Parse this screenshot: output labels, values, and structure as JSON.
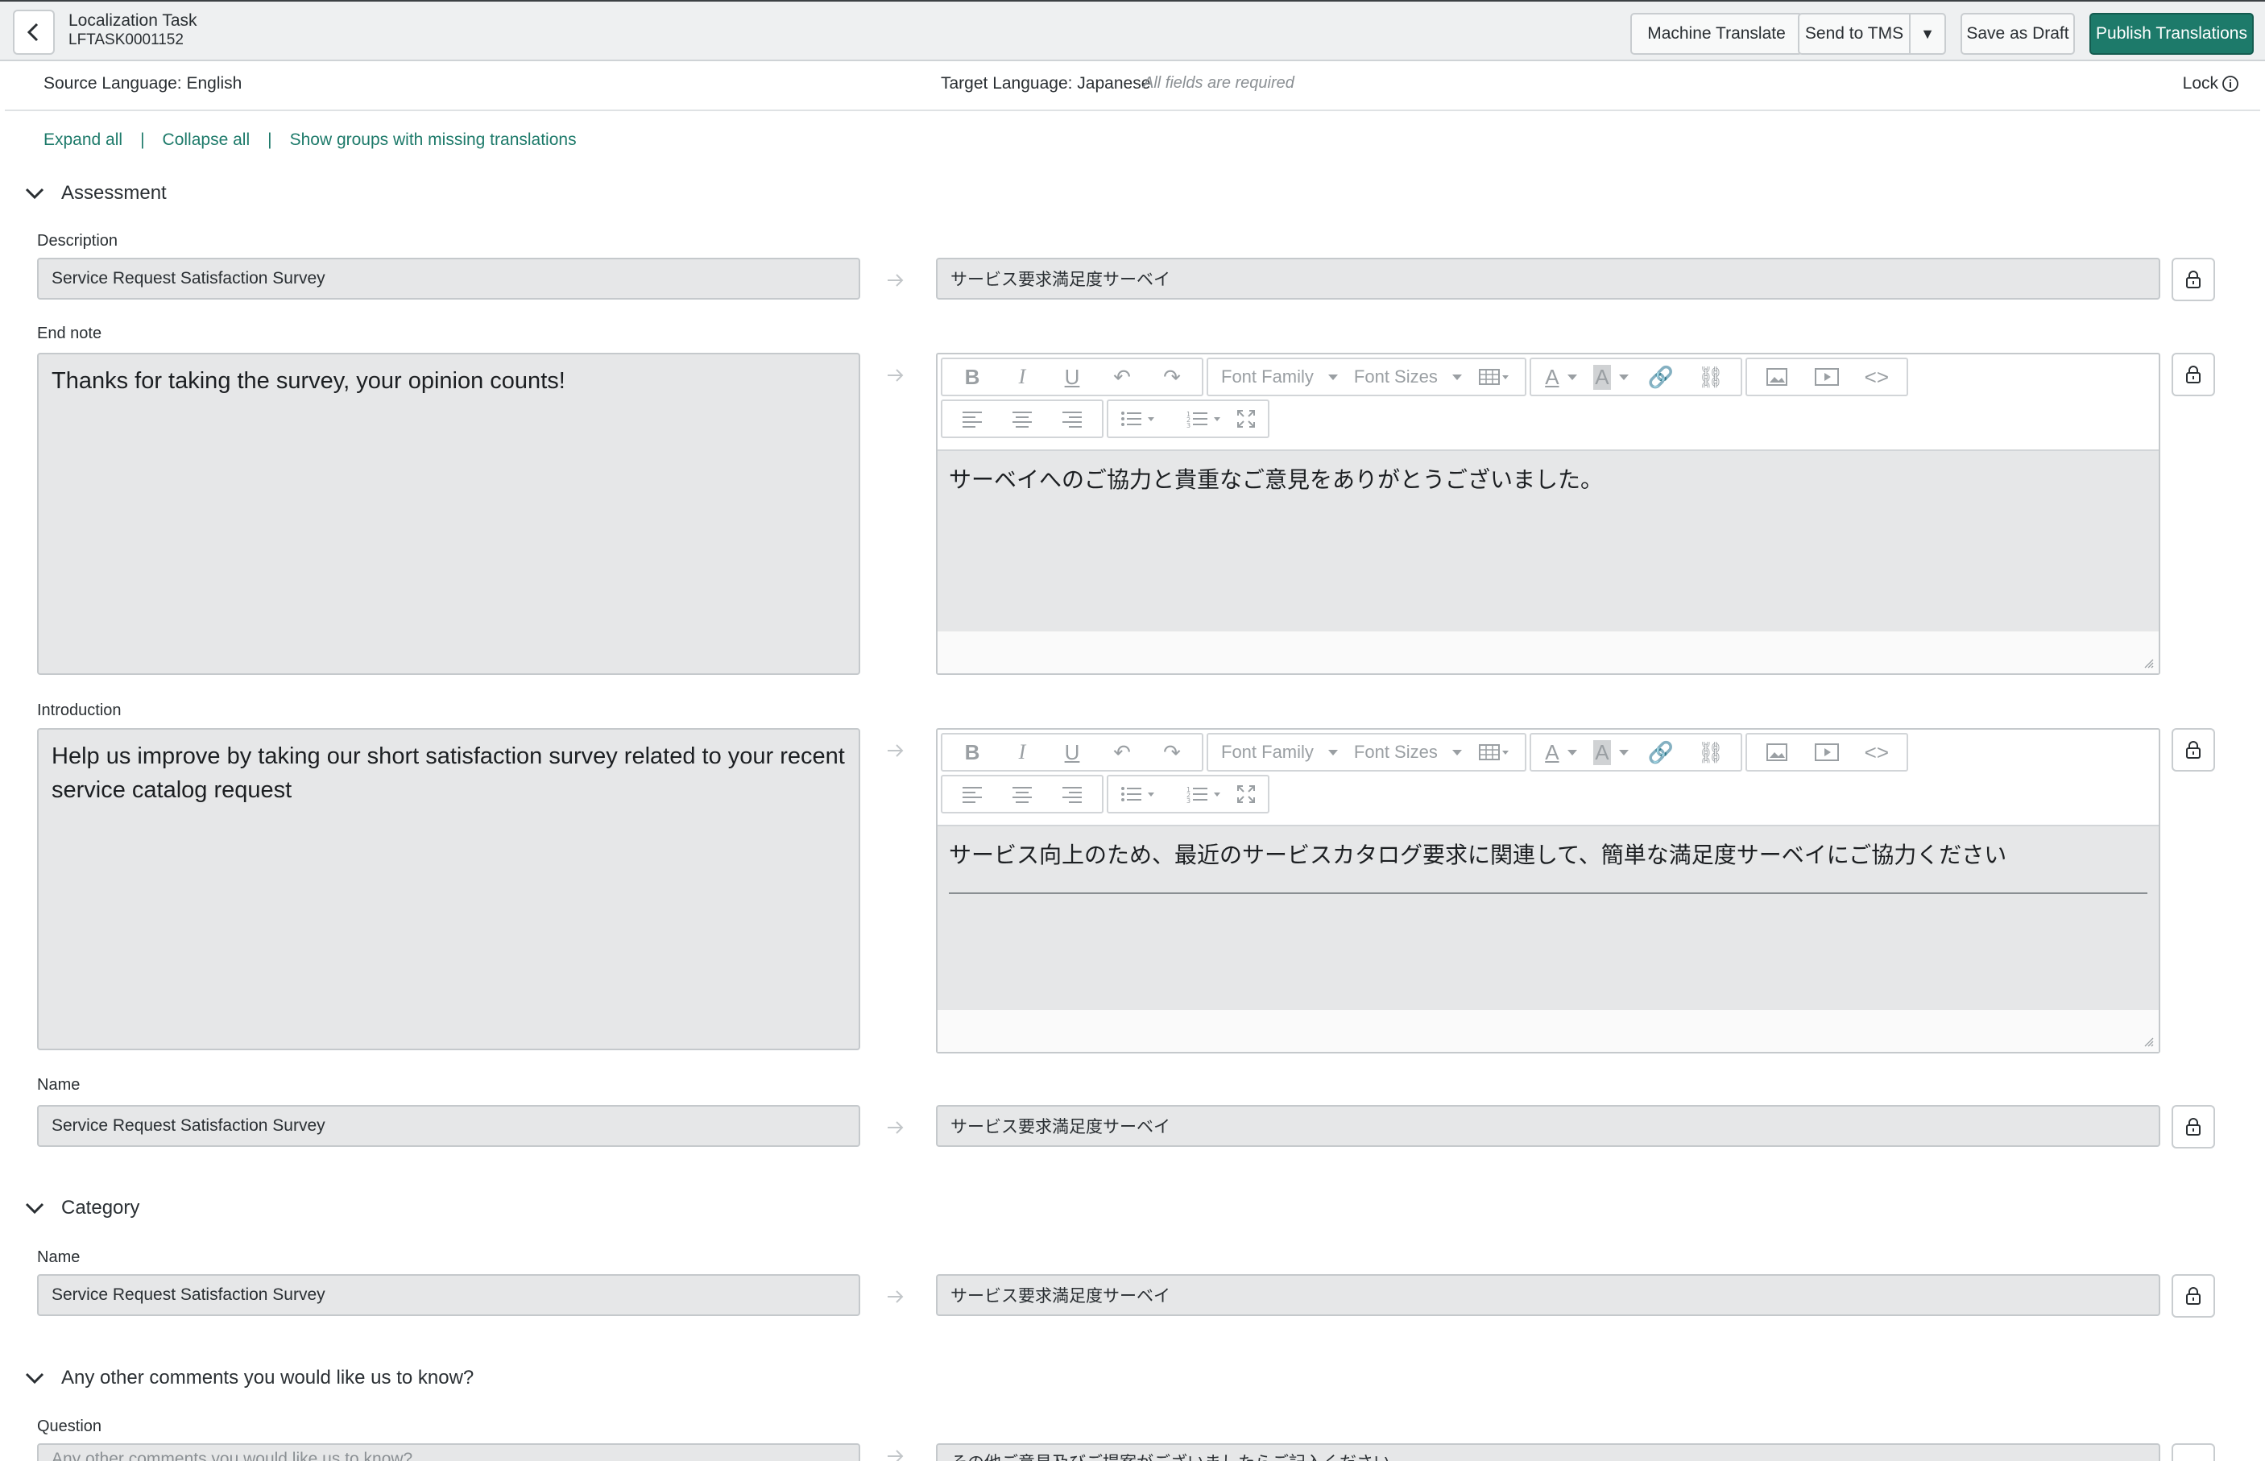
{
  "header": {
    "title": "Localization Task",
    "number": "LFTASK0001152",
    "buttons": {
      "machine_translate": "Machine Translate",
      "send_to_tms": "Send to TMS",
      "save_draft": "Save as Draft",
      "publish": "Publish Translations"
    }
  },
  "langbar": {
    "source": "Source Language: English",
    "target": "Target Language: Japanese",
    "required": "All fields are required",
    "lock": "Lock"
  },
  "links": {
    "expand": "Expand all",
    "collapse": "Collapse all",
    "missing": "Show groups with missing translations",
    "separator": "|"
  },
  "editor_toolbar": {
    "font_family": "Font Family",
    "font_sizes": "Font Sizes"
  },
  "sections": {
    "assessment": {
      "title": "Assessment",
      "description": {
        "label": "Description",
        "source": "Service Request Satisfaction Survey",
        "target": "サービス要求満足度サーベイ"
      },
      "end_note": {
        "label": "End note",
        "source": "Thanks for taking the survey, your opinion counts!",
        "target": "サーベイへのご協力と貴重なご意見をありがとうございました。"
      },
      "introduction": {
        "label": "Introduction",
        "source": "Help us improve by taking our short satisfaction survey related to your recent service catalog request",
        "target": "サービス向上のため、最近のサービスカタログ要求に関連して、簡単な満足度サーベイにご協力ください"
      },
      "name": {
        "label": "Name",
        "source": "Service Request Satisfaction Survey",
        "target": "サービス要求満足度サーベイ"
      }
    },
    "category": {
      "title": "Category",
      "name": {
        "label": "Name",
        "source": "Service Request Satisfaction Survey",
        "target": "サービス要求満足度サーベイ"
      }
    },
    "comments": {
      "title": "Any other comments you would like us to know?",
      "question": {
        "label": "Question",
        "source": "Any other comments you would like us to know?",
        "target": "その他ご意見及びご提案がございましたらご記入ください"
      }
    }
  }
}
